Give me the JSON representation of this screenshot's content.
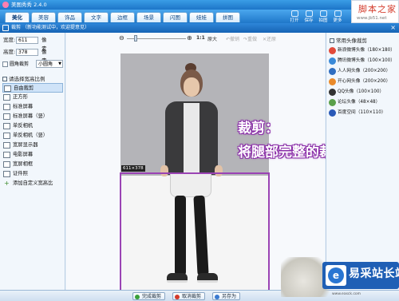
{
  "app": {
    "title": "美图秀秀 2.4.0",
    "logo_text": "美图秀秀"
  },
  "nav": {
    "tabs": [
      {
        "label": "美化"
      },
      {
        "label": "美容"
      },
      {
        "label": "饰品"
      },
      {
        "label": "文字"
      },
      {
        "label": "边框"
      },
      {
        "label": "场景"
      },
      {
        "label": "闪图"
      },
      {
        "label": "娃娃"
      },
      {
        "label": "拼图"
      }
    ],
    "tools": [
      {
        "label": "打开"
      },
      {
        "label": "保存"
      },
      {
        "label": "拍图"
      },
      {
        "label": "更多"
      }
    ]
  },
  "watermark": {
    "text": "脚本之家",
    "url": "www.jb51.net"
  },
  "subbar": {
    "title": "裁剪",
    "status": "（新功能测试中，欢迎提意见）",
    "close": "×"
  },
  "left_panel": {
    "width_label": "宽度:",
    "width_value": "611",
    "width_unit": "像素",
    "height_label": "高度:",
    "height_value": "378",
    "height_unit": "像素",
    "round_crop_label": "圆角裁剪",
    "round_select": "小圆角",
    "section_title": "请选择宽高比例",
    "ratios": [
      {
        "label": "自由裁剪",
        "selected": true
      },
      {
        "label": "正方形",
        "selected": false
      },
      {
        "label": "标准屏幕",
        "selected": false
      },
      {
        "label": "标准屏幕（竖）",
        "selected": false
      },
      {
        "label": "单反相机",
        "selected": false
      },
      {
        "label": "单反相机（竖）",
        "selected": false
      },
      {
        "label": "宽屏显示器",
        "selected": false
      },
      {
        "label": "电影屏幕",
        "selected": false
      },
      {
        "label": "宽屏相框",
        "selected": false
      },
      {
        "label": "证件照",
        "selected": false
      }
    ],
    "add_custom": "添加自定义宽高比"
  },
  "zoom": {
    "ratio": "1:1",
    "original": "原大",
    "undo": "撤销",
    "redo": "重做",
    "reset": "还原"
  },
  "canvas": {
    "dimension_label": "611×378"
  },
  "callout": {
    "line1": "裁剪：",
    "line2": "将腿部完整的裁减出来"
  },
  "right_panel": {
    "title": "常用头像裁剪",
    "items": [
      {
        "label": "新浪微博头像（180×180）",
        "color": "#e24a3a"
      },
      {
        "label": "腾讯微博头像（100×100）",
        "color": "#3a8ad8"
      },
      {
        "label": "人人网头像（200×200）",
        "color": "#2f6ec0"
      },
      {
        "label": "开心网头像（200×200）",
        "color": "#e98a2a"
      },
      {
        "label": "QQ头像（100×100）",
        "color": "#333333"
      },
      {
        "label": "论坛头像（48×48）",
        "color": "#5aa04a"
      },
      {
        "label": "百度空间（110×110）",
        "color": "#2a5ab8"
      }
    ]
  },
  "bottom": {
    "confirm": "完成裁剪",
    "cancel": "取消裁剪",
    "save_as": "另存为"
  },
  "brand": {
    "text": "易采站长站",
    "url": "www.easck.com",
    "icon_char": "e"
  },
  "colors": {
    "accent": "#1d75c8",
    "crop_border": "#9a43b4",
    "callout": "#8a2da8"
  }
}
